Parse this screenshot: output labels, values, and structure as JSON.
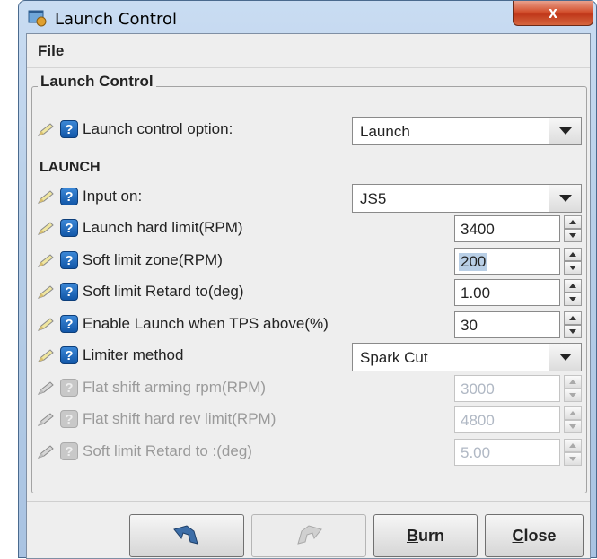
{
  "window": {
    "title": "Launch Control",
    "close_glyph": "x"
  },
  "menu": {
    "file_first": "F",
    "file_rest": "ile"
  },
  "group": {
    "title": "Launch Control"
  },
  "launch_option": {
    "label": "Launch control option:",
    "value": "Launch",
    "interactable": true
  },
  "section": {
    "label": "LAUNCH"
  },
  "fields": [
    {
      "label": "Input on:",
      "kind": "combo",
      "value": "JS5",
      "enabled": true
    },
    {
      "label": "Launch hard limit(RPM)",
      "kind": "spin",
      "value": "3400",
      "enabled": true
    },
    {
      "label": "Soft limit zone(RPM)",
      "kind": "spin",
      "value": "200",
      "enabled": true,
      "selected": true
    },
    {
      "label": "Soft limit Retard to(deg)",
      "kind": "spin",
      "value": "1.00",
      "enabled": true
    },
    {
      "label": "Enable Launch when TPS above(%)",
      "kind": "spin",
      "value": "30",
      "enabled": true
    },
    {
      "label": "Limiter method",
      "kind": "combo",
      "value": "Spark Cut",
      "enabled": true
    },
    {
      "label": "Flat shift arming rpm(RPM)",
      "kind": "spin",
      "value": "3000",
      "enabled": false
    },
    {
      "label": "Flat shift hard rev limit(RPM)",
      "kind": "spin",
      "value": "4800",
      "enabled": false
    },
    {
      "label": "Soft limit Retard to :(deg)",
      "kind": "spin",
      "value": "5.00",
      "enabled": false
    }
  ],
  "buttons": {
    "burn_first": "B",
    "burn_rest": "urn",
    "close_first": "C",
    "close_rest": "lose"
  },
  "icons": {
    "app": "app-window-icon",
    "pen": "pencil-icon",
    "help": "help-question-icon",
    "undo": "undo-arrow-icon",
    "redo": "redo-arrow-icon"
  },
  "colors": {
    "help_blue": "#1257a8",
    "close_red": "#c0381a",
    "selection": "#b9cfe6"
  },
  "help_glyph": "?"
}
